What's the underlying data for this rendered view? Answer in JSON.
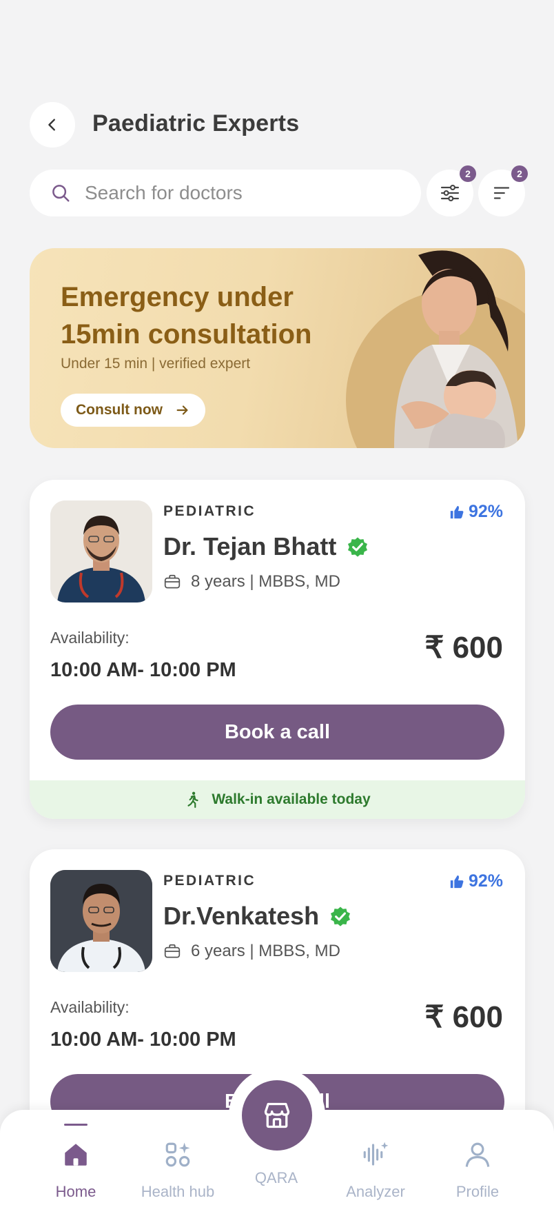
{
  "header": {
    "title": "Paediatric Experts"
  },
  "search": {
    "placeholder": "Search for doctors",
    "filter_count": "2",
    "sort_count": "2"
  },
  "banner": {
    "title": "Emergency under 15min consultation",
    "subtitle": "Under 15 min | verified expert",
    "cta_label": "Consult now"
  },
  "doctors": [
    {
      "specialty": "PEDIATRIC",
      "rating": "92%",
      "name": "Dr. Tejan Bhatt",
      "experience": "8 years | MBBS, MD",
      "availability_label": "Availability:",
      "availability_time": "10:00 AM- 10:00 PM",
      "price": "₹ 600",
      "cta_label": "Book a call",
      "walkin": "Walk-in available today"
    },
    {
      "specialty": "PEDIATRIC",
      "rating": "92%",
      "name": "Dr.Venkatesh",
      "experience": "6 years | MBBS, MD",
      "availability_label": "Availability:",
      "availability_time": "10:00 AM- 10:00 PM",
      "price": "₹ 600",
      "cta_label": "Book a call"
    }
  ],
  "nav": {
    "home": "Home",
    "health_hub": "Health hub",
    "qara": "QARA",
    "analyzer": "Analyzer",
    "profile": "Profile"
  },
  "colors": {
    "primary": "#765a83",
    "rating_blue": "#3d74e0",
    "verified_green": "#3ab54a",
    "banner_text": "#8a5e16",
    "walkin_bg": "#e8f6e6"
  }
}
